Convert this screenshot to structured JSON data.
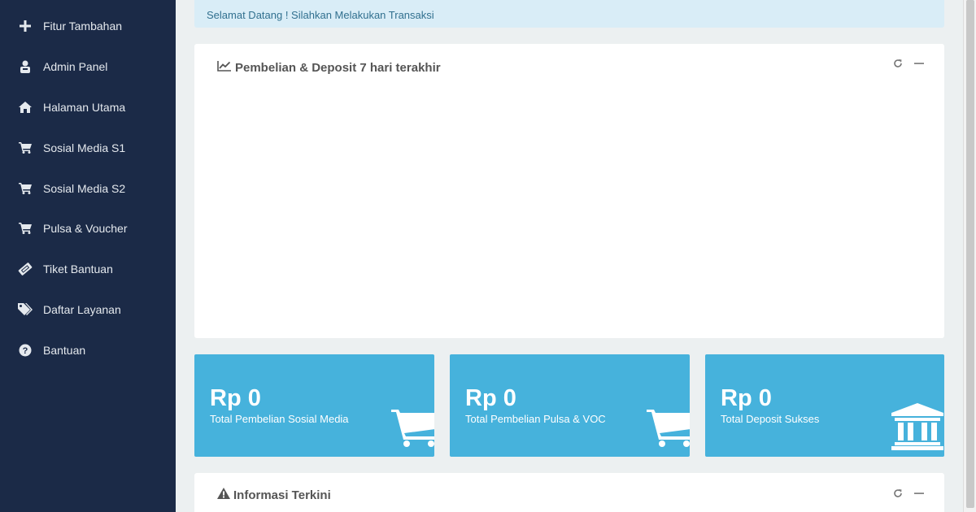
{
  "sidebar": {
    "items": [
      {
        "label": "Fitur Tambahan",
        "icon": "plus-icon"
      },
      {
        "label": "Admin Panel",
        "icon": "admin-icon"
      },
      {
        "label": "Halaman Utama",
        "icon": "home-icon"
      },
      {
        "label": "Sosial Media S1",
        "icon": "cart-icon"
      },
      {
        "label": "Sosial Media S2",
        "icon": "cart-icon"
      },
      {
        "label": "Pulsa & Voucher",
        "icon": "cart-icon"
      },
      {
        "label": "Tiket Bantuan",
        "icon": "ticket-icon"
      },
      {
        "label": "Daftar Layanan",
        "icon": "tags-icon"
      },
      {
        "label": "Bantuan",
        "icon": "question-circle-icon"
      }
    ]
  },
  "alert": {
    "text": "Selamat Datang ! Silahkan Melakukan Transaksi"
  },
  "chart_box": {
    "title": "Pembelian & Deposit 7 hari terakhir",
    "icon": "line-chart-icon"
  },
  "stats": [
    {
      "value": "Rp 0",
      "label": "Total Pembelian Sosial Media",
      "icon": "cart-icon"
    },
    {
      "value": "Rp 0",
      "label": "Total Pembelian Pulsa & VOC",
      "icon": "cart-icon"
    },
    {
      "value": "Rp 0",
      "label": "Total Deposit Sukses",
      "icon": "bank-icon"
    }
  ],
  "info_box": {
    "title": "Informasi Terkini",
    "icon": "warning-icon"
  },
  "colors": {
    "sidebar_bg": "#1b2a47",
    "stat_bg": "#46b2dc",
    "alert_bg": "#d9edf7",
    "alert_text": "#31708f",
    "page_bg": "#ecf0f1"
  }
}
